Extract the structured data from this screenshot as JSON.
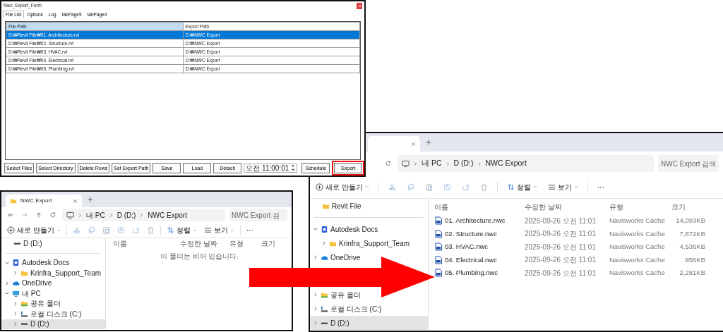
{
  "form": {
    "title": "Nwc_Export_Form",
    "tabs": [
      {
        "label": "File List",
        "selected": true
      },
      {
        "label": "Options",
        "selected": false
      },
      {
        "label": "Log",
        "selected": false
      },
      {
        "label": "tabPage5",
        "selected": false
      },
      {
        "label": "tabPage4",
        "selected": false
      }
    ],
    "columns": [
      {
        "label": "File Path",
        "highlighted": true
      },
      {
        "label": "Export Path",
        "highlighted": false
      }
    ],
    "rows": [
      {
        "file_path": "D:₩Revit File₩01. Architecture.rvt",
        "export_path": "D:₩NWC Export",
        "selected": true
      },
      {
        "file_path": "D:₩Revit File₩02. Structure.rvt",
        "export_path": "D:₩NWC Export",
        "selected": false
      },
      {
        "file_path": "D:₩Revit File₩03. HVAC.rvt",
        "export_path": "D:₩NWC Export",
        "selected": false
      },
      {
        "file_path": "D:₩Revit File₩04. Electrical.rvt",
        "export_path": "D:₩NWC Export",
        "selected": false
      },
      {
        "file_path": "D:₩Revit File₩05. Plumbing.rvt",
        "export_path": "D:₩NWC Export",
        "selected": false
      }
    ],
    "controls": [
      {
        "kind": "button",
        "label": "Select Files",
        "highlighted": false
      },
      {
        "kind": "button",
        "label": "Select Directory",
        "highlighted": false
      },
      {
        "kind": "button",
        "label": "Delete Rows",
        "highlighted": false
      },
      {
        "kind": "button",
        "label": "Set Export Path",
        "highlighted": false
      },
      {
        "kind": "button",
        "label": "Save",
        "highlighted": false
      },
      {
        "kind": "button",
        "label": "Load",
        "highlighted": false
      },
      {
        "kind": "button",
        "label": "Detach",
        "highlighted": false
      },
      {
        "kind": "time",
        "value": "오전 11:00:01"
      },
      {
        "kind": "button",
        "label": "Schedule",
        "highlighted": false
      },
      {
        "kind": "button",
        "label": "Export",
        "highlighted": true
      }
    ]
  },
  "explorer_before": {
    "tab": {
      "title": "NWC Export",
      "closable": true
    },
    "nav_buttons": [
      {
        "kind": "back"
      },
      {
        "kind": "forward"
      },
      {
        "kind": "up"
      },
      {
        "kind": "refresh"
      }
    ],
    "breadcrumb": [
      "내 PC",
      "D (D:)",
      "NWC Export"
    ],
    "search": {
      "placeholder": "NWC Export 검"
    },
    "toolbar": {
      "new_label": "새로 만들기",
      "actions": [
        {
          "kind": "cut"
        },
        {
          "kind": "copy"
        },
        {
          "kind": "paste"
        },
        {
          "kind": "rename"
        },
        {
          "kind": "share"
        },
        {
          "kind": "delete"
        }
      ],
      "sort_label": "정렬",
      "view_label": "보기",
      "more": "···"
    },
    "sidebar": [
      [
        {
          "label": "D (D:)",
          "kind": "drive",
          "selected": false
        }
      ],
      [
        {
          "label": "Autodesk Docs",
          "kind": "docs",
          "expanded": true,
          "selected": false,
          "children": [
            {
              "label": "Krinfra_Support_Team",
              "kind": "folder",
              "expanded": false,
              "selected": false
            }
          ]
        },
        {
          "label": "OneDrive",
          "kind": "cloud",
          "expanded": false,
          "selected": false
        },
        {
          "label": "내 PC",
          "kind": "pc",
          "expanded": true,
          "selected": false,
          "children": [
            {
              "label": "공유 폴더",
              "kind": "shared",
              "expanded": false,
              "selected": false
            },
            {
              "label": "로컬 디스크 (C:)",
              "kind": "disk",
              "expanded": false,
              "selected": false
            },
            {
              "label": "D (D:)",
              "kind": "drive",
              "expanded": false,
              "selected": true
            }
          ]
        }
      ]
    ],
    "columns": [
      "이름",
      "수정한 날짜",
      "유형",
      "크기"
    ],
    "empty_message": "이 폴더는 비어 있습니다."
  },
  "explorer_after": {
    "tab": {
      "closable": true
    },
    "nav_buttons": [
      {
        "kind": "refresh"
      }
    ],
    "breadcrumb": [
      "내 PC",
      "D (D:)",
      "NWC Export"
    ],
    "search": {
      "placeholder": "NWC Export 검색"
    },
    "toolbar": {
      "new_label": "새로 만들기",
      "actions": [
        {
          "kind": "cut"
        },
        {
          "kind": "copy"
        },
        {
          "kind": "paste"
        },
        {
          "kind": "rename"
        },
        {
          "kind": "share"
        },
        {
          "kind": "delete"
        }
      ],
      "sort_label": "정렬",
      "view_label": "보기",
      "more": "···"
    },
    "sidebar": [
      [
        {
          "label": "Revit File",
          "kind": "folder",
          "selected": false
        }
      ],
      [
        {
          "label": "Autodesk Docs",
          "kind": "docs",
          "expanded": true,
          "selected": false,
          "children": [
            {
              "label": "Krinfra_Support_Team",
              "kind": "folder",
              "expanded": false,
              "selected": false
            }
          ]
        },
        {
          "label": "OneDrive",
          "kind": "cloud",
          "expanded": false,
          "selected": false
        }
      ],
      [
        {
          "label": "공유 폴더",
          "kind": "shared",
          "expanded": false,
          "selected": false
        },
        {
          "label": "로컬 디스크 (C:)",
          "kind": "disk",
          "expanded": false,
          "selected": false
        },
        {
          "label": "D (D:)",
          "kind": "drive",
          "expanded": false,
          "selected": true
        }
      ]
    ],
    "columns": [
      "이름",
      "수정한 날짜",
      "유형",
      "크기"
    ],
    "files": [
      {
        "name": "01. Architecture.nwc",
        "modified": "2025-09-26 오전 11:01",
        "type": "Navisworks Cache",
        "size": "14,093KB"
      },
      {
        "name": "02. Structure.nwc",
        "modified": "2025-09-26 오전 11:01",
        "type": "Navisworks Cache",
        "size": "7,872KB"
      },
      {
        "name": "03. HVAC.nwc",
        "modified": "2025-09-26 오전 11:01",
        "type": "Navisworks Cache",
        "size": "4,536KB"
      },
      {
        "name": "04. Electrical.nwc",
        "modified": "2025-09-26 오전 11:01",
        "type": "Navisworks Cache",
        "size": "956KB"
      },
      {
        "name": "05. Plumbing.nwc",
        "modified": "2025-09-26 오전 11:01",
        "type": "Navisworks Cache",
        "size": "2,281KB"
      }
    ]
  }
}
